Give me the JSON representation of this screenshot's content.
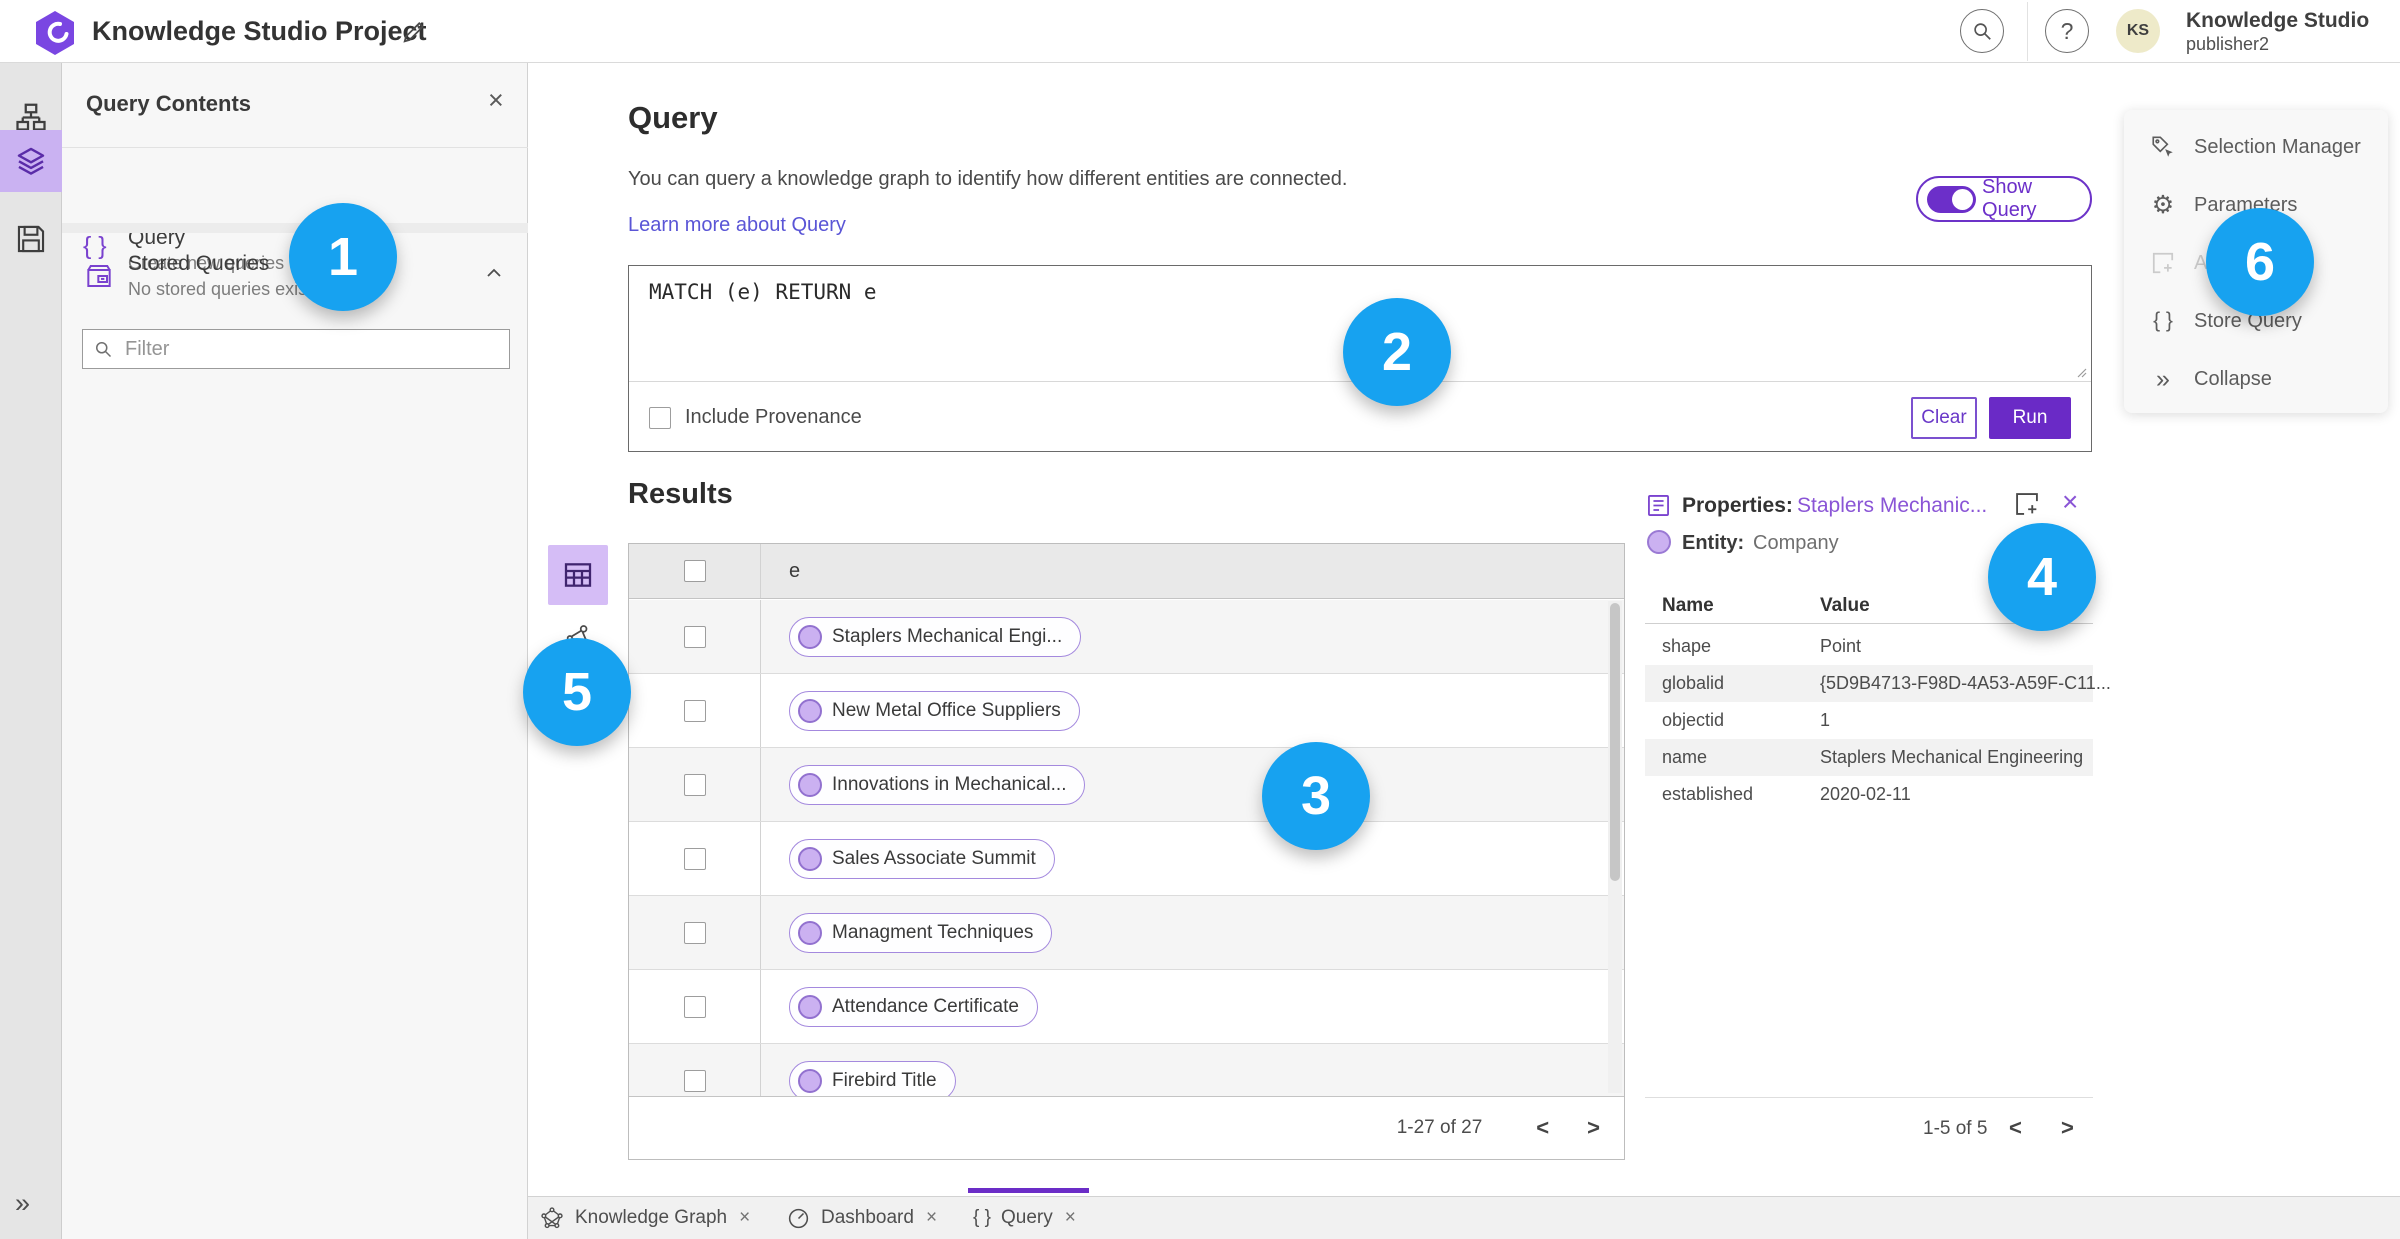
{
  "header": {
    "title": "Knowledge Studio Project",
    "user": {
      "name": "Knowledge Studio",
      "subtitle": "publisher2",
      "initials": "KS"
    }
  },
  "icons": {
    "help": "?",
    "close": "×",
    "braces": "{ }",
    "collapse": "»",
    "expand": "»",
    "chevron_left": "<",
    "chevron_right": ">",
    "gear": "⚙"
  },
  "left_panel": {
    "title": "Query Contents",
    "query_item": {
      "label": "Query",
      "sublabel": "Create new queries"
    },
    "stored_item": {
      "label": "Stored Queries",
      "sublabel": "No stored queries exist"
    },
    "filter_placeholder": "Filter"
  },
  "query_section": {
    "title": "Query",
    "description": "You can query a knowledge graph to identify how different entities are connected.",
    "learn_more": "Learn more about Query",
    "show_query": "Show Query",
    "query_text": "MATCH (e) RETURN e",
    "include_provenance": "Include Provenance",
    "clear": "Clear",
    "run": "Run"
  },
  "results": {
    "title": "Results",
    "column": "e",
    "rows": [
      "Staplers Mechanical Engi...",
      "New Metal Office Suppliers",
      "Innovations in Mechanical...",
      "Sales Associate Summit",
      "Managment Techniques",
      "Attendance Certificate",
      "Firebird Title"
    ],
    "pagination": "1-27 of 27"
  },
  "properties": {
    "label": "Properties:",
    "link": "Staplers Mechanic...",
    "entity_label": "Entity:",
    "entity_value": "Company",
    "col_name": "Name",
    "col_value": "Value",
    "rows": [
      {
        "name": "shape",
        "value": "Point"
      },
      {
        "name": "globalid",
        "value": "{5D9B4713-F98D-4A53-A59F-C11..."
      },
      {
        "name": "objectid",
        "value": "1"
      },
      {
        "name": "name",
        "value": "Staplers Mechanical Engineering"
      },
      {
        "name": "established",
        "value": "2020-02-11"
      }
    ],
    "pagination": "1-5 of 5"
  },
  "side_menu": {
    "items": [
      {
        "label": "Selection Manager"
      },
      {
        "label": "Parameters"
      },
      {
        "label": "Add"
      },
      {
        "label": "Store Query"
      },
      {
        "label": "Collapse"
      }
    ]
  },
  "bottom_tabs": [
    {
      "label": "Knowledge Graph"
    },
    {
      "label": "Dashboard"
    },
    {
      "label": "Query"
    }
  ],
  "annotations": [
    "1",
    "2",
    "3",
    "4",
    "5",
    "6"
  ],
  "colors": {
    "accent_purple": "#6a2dc6",
    "selected_rail": "#cab2f2",
    "annotation_blue": "#17a2f0",
    "link_color": "#5a55d6",
    "properties_link": "#8a55d6",
    "entity_fill": "#cbb1f1",
    "entity_border": "#9271cf"
  }
}
